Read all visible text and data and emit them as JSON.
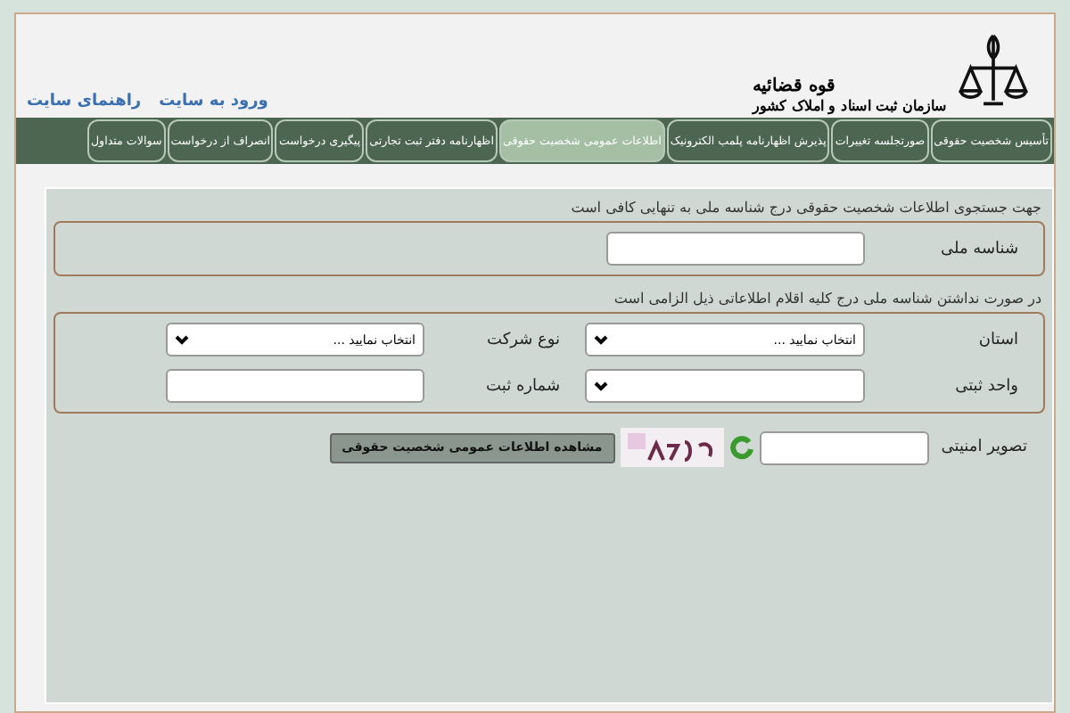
{
  "header": {
    "logo_line_1": "قوه قضائیه",
    "logo_line_2": "سازمان ثبت اسناد و املاک کشور",
    "links": [
      "ورود به سایت",
      "راهنمای سایت"
    ]
  },
  "nav": [
    {
      "label": "تأسیس شخصیت حقوقی",
      "selected": false
    },
    {
      "label": "صورتجلسه تغییرات",
      "selected": false
    },
    {
      "label": "پذیرش اظهارنامه پلمب الکترونیک",
      "selected": false
    },
    {
      "label": "اطلاعات عمومی شخصیت حقوقی",
      "selected": true
    },
    {
      "label": "اظهارنامه دفتر ثبت تجارتی",
      "selected": false
    },
    {
      "label": "پیگیری درخواست",
      "selected": false
    },
    {
      "label": "انصراف از درخواست",
      "selected": false
    },
    {
      "label": "سوالات متداول",
      "selected": false
    }
  ],
  "form": {
    "note_1": "جهت جستجوی اطلاعات شخصیت حقوقی درج شناسه ملی به تنهایی کافی است",
    "national_id_label": "شناسه ملی",
    "note_2": "در صورت نداشتن شناسه ملی درج کلیه اقلام اطلاعاتی ذیل الزامی است",
    "fields": [
      {
        "label": "استان",
        "kind": "select",
        "value": "انتخاب نمایید ..."
      },
      {
        "label": "نوع شرکت",
        "kind": "select",
        "value": "انتخاب نمایید ..."
      },
      {
        "label": "واحد ثبتی",
        "kind": "select"
      },
      {
        "label": "شماره ثبت",
        "kind": "text"
      }
    ],
    "captcha_label": "تصویر امنیتی",
    "submit": "مشاهده اطلاعات عمومی شخصیت حقوقی"
  }
}
